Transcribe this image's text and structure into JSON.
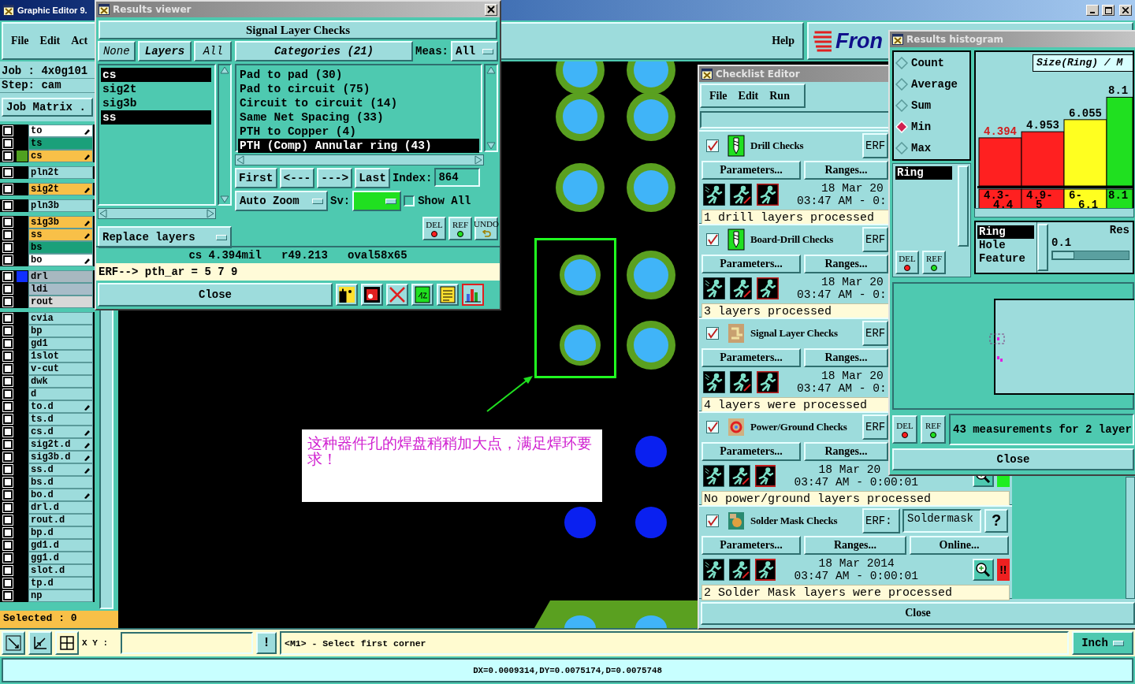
{
  "main_window": {
    "title": "Graphic Editor 9.",
    "menu": [
      "File",
      "Edit",
      "Act"
    ],
    "help": "Help",
    "logo_text": "Fron"
  },
  "job_panel": {
    "job": "Job : 4x0g101",
    "step": "Step: cam",
    "matrix_button": "Job Matrix .",
    "selected": "Selected : 0",
    "layer_groups": [
      {
        "layers": [
          {
            "name": "to",
            "color": "#ffffff",
            "checked": false,
            "linked": true
          },
          {
            "name": "ts",
            "color": "#1aa07a",
            "checked": false,
            "linked": false
          },
          {
            "name": "cs",
            "color": "#f8c048",
            "checked": false,
            "linked": true,
            "display": {
              "color": "#50a020"
            }
          }
        ]
      },
      {
        "layers": [
          {
            "name": "pln2t",
            "color": "#9ddcdc",
            "checked": false,
            "linked": false
          }
        ]
      },
      {
        "layers": [
          {
            "name": "sig2t",
            "color": "#f8c048",
            "checked": false,
            "linked": true
          }
        ]
      },
      {
        "layers": [
          {
            "name": "pln3b",
            "color": "#9ddcdc",
            "checked": false,
            "linked": false
          }
        ]
      },
      {
        "layers": [
          {
            "name": "sig3b",
            "color": "#f8c048",
            "checked": false,
            "linked": true
          },
          {
            "name": "ss",
            "color": "#f8c048",
            "checked": false,
            "linked": true
          },
          {
            "name": "bs",
            "color": "#1aa07a",
            "checked": false,
            "linked": false
          },
          {
            "name": "bo",
            "color": "#ffffff",
            "checked": false,
            "linked": true
          }
        ]
      },
      {
        "layers": [
          {
            "name": "drl",
            "color": "#a8b8c0",
            "checked": false,
            "linked": false,
            "display": {
              "color": "#1030ff"
            }
          },
          {
            "name": "ldi",
            "color": "#a8bcc8",
            "checked": false,
            "linked": false
          },
          {
            "name": "rout",
            "color": "#d8d8d8",
            "checked": false,
            "linked": false
          }
        ]
      },
      {
        "layers": [
          {
            "name": "cvia",
            "color": "#9ddcdc",
            "checked": false,
            "linked": false
          },
          {
            "name": "bp",
            "color": "#9ddcdc",
            "checked": false,
            "linked": false
          },
          {
            "name": "gd1",
            "color": "#9ddcdc",
            "checked": false,
            "linked": false
          },
          {
            "name": "1slot",
            "color": "#9ddcdc",
            "checked": false,
            "linked": false
          },
          {
            "name": "v-cut",
            "color": "#9ddcdc",
            "checked": false,
            "linked": false
          },
          {
            "name": "dwk",
            "color": "#9ddcdc",
            "checked": false,
            "linked": false
          },
          {
            "name": "d",
            "color": "#9ddcdc",
            "checked": false,
            "linked": false
          },
          {
            "name": "to.d",
            "color": "#9ddcdc",
            "checked": false,
            "linked": true
          },
          {
            "name": "ts.d",
            "color": "#9ddcdc",
            "checked": false,
            "linked": false
          },
          {
            "name": "cs.d",
            "color": "#9ddcdc",
            "checked": false,
            "linked": true
          },
          {
            "name": "sig2t.d",
            "color": "#9ddcdc",
            "checked": false,
            "linked": true
          },
          {
            "name": "sig3b.d",
            "color": "#9ddcdc",
            "checked": false,
            "linked": true
          },
          {
            "name": "ss.d",
            "color": "#9ddcdc",
            "checked": false,
            "linked": true
          },
          {
            "name": "bs.d",
            "color": "#9ddcdc",
            "checked": false,
            "linked": false
          },
          {
            "name": "bo.d",
            "color": "#9ddcdc",
            "checked": false,
            "linked": true
          },
          {
            "name": "drl.d",
            "color": "#9ddcdc",
            "checked": false,
            "linked": false
          },
          {
            "name": "rout.d",
            "color": "#9ddcdc",
            "checked": false,
            "linked": false
          },
          {
            "name": "bp.d",
            "color": "#9ddcdc",
            "checked": false,
            "linked": false
          },
          {
            "name": "gd1.d",
            "color": "#9ddcdc",
            "checked": false,
            "linked": false
          },
          {
            "name": "gg1.d",
            "color": "#9ddcdc",
            "checked": false,
            "linked": false
          },
          {
            "name": "slot.d",
            "color": "#9ddcdc",
            "checked": false,
            "linked": false
          },
          {
            "name": "tp.d",
            "color": "#9ddcdc",
            "checked": false,
            "linked": false
          },
          {
            "name": "np",
            "color": "#9ddcdc",
            "checked": false,
            "linked": false
          }
        ]
      }
    ]
  },
  "canvas": {
    "annotation": "这种器件孔的焊盘稍稍加大点，满足焊环要求！"
  },
  "command_bar": {
    "xy_label": "X Y :",
    "alert_button": "!",
    "prompt": "<M1> - Select first corner",
    "units": "Inch",
    "status": "DX=0.0009314,DY=0.0075174,D=0.0075748"
  },
  "results_viewer": {
    "title": "Results viewer",
    "header": "Signal Layer Checks",
    "layer_buttons": [
      "None",
      "Layers",
      "All"
    ],
    "layers": [
      {
        "name": "cs",
        "selected": true
      },
      {
        "name": "sig2t",
        "selected": false
      },
      {
        "name": "sig3b",
        "selected": false
      },
      {
        "name": "ss",
        "selected": true
      }
    ],
    "categories_button": "Categories (21)",
    "meas_label": "Meas:",
    "meas_value": "All",
    "categories": [
      {
        "label": "Pad to pad (30)",
        "selected": false
      },
      {
        "label": "Pad to circuit (75)",
        "selected": false
      },
      {
        "label": "Circuit to circuit (14)",
        "selected": false
      },
      {
        "label": "Same Net Spacing (33)",
        "selected": false
      },
      {
        "label": "PTH to Copper (4)",
        "selected": false
      },
      {
        "label": "PTH (Comp) Annular ring (43)",
        "selected": true
      }
    ],
    "nav_buttons": [
      "First",
      "<---",
      "--->",
      "Last"
    ],
    "index_label": "Index:",
    "index_value": "864",
    "zoom_mode": "Auto Zoom",
    "sv_label": "Sv:",
    "show_all": {
      "label": "Show All",
      "checked": false
    },
    "replace_mode": "Replace layers",
    "edit_buttons": [
      "DEL",
      "REF",
      "UNDO"
    ],
    "info": "cs 4.394mil   r49.213   oval58x65",
    "erf_line": "ERF--> pth_ar = 5 7 9",
    "close_button": "Close"
  },
  "checklist_editor": {
    "title": "Checklist Editor",
    "menu": [
      "File",
      "Edit",
      "Run"
    ],
    "checks": [
      {
        "name": "Drill Checks",
        "kind": "drill",
        "checked": true,
        "erf": "ERF",
        "buttons": [
          "Parameters...",
          "Ranges..."
        ],
        "date": "18 Mar 20",
        "time": "03:47 AM - 0:",
        "summary": "1 drill layers processed",
        "zoom_button": false
      },
      {
        "name": "Board-Drill Checks",
        "kind": "drill",
        "checked": true,
        "erf": "ERF",
        "buttons": [
          "Parameters...",
          "Ranges..."
        ],
        "date": "18 Mar 20",
        "time": "03:47 AM - 0:",
        "summary": "3 layers processed",
        "zoom_button": false
      },
      {
        "name": "Signal Layer Checks",
        "kind": "signal",
        "checked": true,
        "erf": "ERF",
        "buttons": [
          "Parameters...",
          "Ranges..."
        ],
        "date": "18 Mar 20",
        "time": "03:47 AM - 0:",
        "summary": "4 layers were processed",
        "zoom_button": false
      },
      {
        "name": "Power/Ground Checks",
        "kind": "power",
        "checked": true,
        "erf": "ERF",
        "buttons": [
          "Parameters...",
          "Ranges..."
        ],
        "date": "18 Mar 20",
        "time": "03:47 AM - 0:00:01",
        "summary": "No power/ground layers processed",
        "zoom_button": true,
        "status": {
          "color": "#20ee20"
        }
      },
      {
        "name": "Solder Mask Checks",
        "kind": "mask",
        "checked": true,
        "erf": "ERF:",
        "erf_value": "Soldermask",
        "help": "?",
        "buttons": [
          "Parameters...",
          "Ranges...",
          "Online..."
        ],
        "date": "18 Mar 2014",
        "time": "03:47 AM - 0:00:01",
        "summary": "2 Solder Mask layers were processed",
        "zoom_button": true,
        "status": {
          "color": "#ee2020",
          "text": "!!"
        }
      }
    ],
    "close_button": "Close"
  },
  "results_histogram": {
    "title": "Results histogram",
    "modes": [
      {
        "label": "Count",
        "selected": false
      },
      {
        "label": "Average",
        "selected": false
      },
      {
        "label": "Sum",
        "selected": false
      },
      {
        "label": "Min",
        "selected": true
      },
      {
        "label": "Max",
        "selected": false
      }
    ],
    "measures": [
      {
        "label": "Ring",
        "selected": true
      }
    ],
    "bars": [
      {
        "color": "#ff2020"
      },
      {
        "color": "#ff2020"
      },
      {
        "color": "#ffff20"
      },
      {
        "color": "#20e020"
      }
    ],
    "chart_data": {
      "type": "bar",
      "title": "Size(Ring) / M",
      "categories": [
        "4.3-4.4",
        "4.9-5",
        "6-6.1",
        "8.1"
      ],
      "values": [
        4.394,
        4.953,
        6.055,
        8.1
      ],
      "value_labels": [
        "4.394",
        "4.953",
        "6.055",
        "8.1"
      ]
    },
    "fields": [
      {
        "label": "Ring",
        "selected": true
      },
      {
        "label": "Hole",
        "selected": false
      },
      {
        "label": "Feature",
        "selected": false
      }
    ],
    "resolution_label": "Res",
    "resolution_value": "0.1",
    "resolution_slider": {
      "level": 0
    },
    "measure_buttons": [
      "DEL",
      "REF"
    ],
    "edit_buttons": [
      "DEL",
      "REF"
    ],
    "summary": "43 measurements for 2 layer",
    "close_button": "Close"
  }
}
